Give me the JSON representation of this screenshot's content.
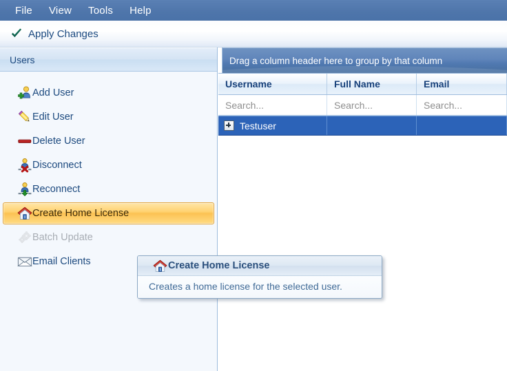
{
  "menubar": {
    "items": [
      {
        "label": "File",
        "name": "menu-file"
      },
      {
        "label": "View",
        "name": "menu-view"
      },
      {
        "label": "Tools",
        "name": "menu-tools"
      },
      {
        "label": "Help",
        "name": "menu-help"
      }
    ]
  },
  "toolbar": {
    "apply_label": "Apply Changes",
    "apply_icon": "check-icon"
  },
  "sidebar": {
    "header_title": "Users",
    "items": [
      {
        "label": "Add User",
        "icon": "add-user-icon",
        "state": "normal"
      },
      {
        "label": "Edit User",
        "icon": "edit-user-icon",
        "state": "normal"
      },
      {
        "label": "Delete User",
        "icon": "delete-user-icon",
        "state": "normal"
      },
      {
        "label": "Disconnect",
        "icon": "disconnect-user-icon",
        "state": "normal"
      },
      {
        "label": "Reconnect",
        "icon": "reconnect-user-icon",
        "state": "normal"
      },
      {
        "label": "Create Home License",
        "icon": "home-license-icon",
        "state": "selected"
      },
      {
        "label": "Batch Update",
        "icon": "batch-update-icon",
        "state": "disabled"
      },
      {
        "label": "Email Clients",
        "icon": "email-clients-icon",
        "state": "normal"
      }
    ]
  },
  "grid": {
    "group_panel_text": "Drag a column header here to group by that column",
    "columns": [
      {
        "header": "Username",
        "search_placeholder": "Search..."
      },
      {
        "header": "Full Name",
        "search_placeholder": "Search..."
      },
      {
        "header": "Email",
        "search_placeholder": "Search..."
      }
    ],
    "rows": [
      {
        "expanded": false,
        "cells": [
          "Testuser",
          "",
          ""
        ],
        "selected": true
      }
    ]
  },
  "tooltip": {
    "title": "Create Home License",
    "body": "Creates a home license for the selected user.",
    "icon": "home-license-icon"
  },
  "colors": {
    "menubar_blue": "#4f76ab",
    "selection_blue": "#2c63b8",
    "highlight_orange": "#fcc253",
    "link_text_blue": "#1d4a7f",
    "header_text_blue": "#17407a"
  }
}
